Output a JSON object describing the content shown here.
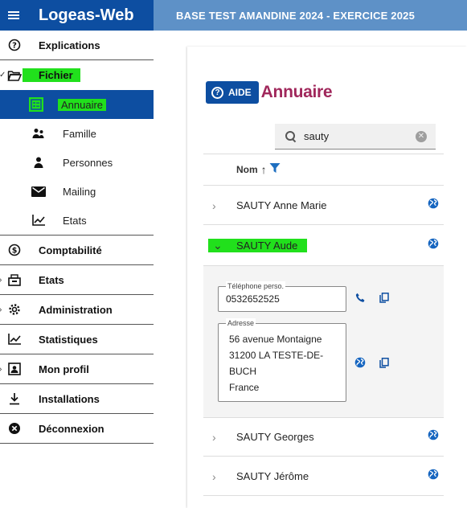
{
  "app": {
    "title": "Logeas-Web",
    "banner": "BASE TEST AMANDINE 2024 - EXERCICE 2025"
  },
  "sidebar": {
    "items": [
      {
        "label": "Explications",
        "icon": "help-circle-icon"
      },
      {
        "label": "Fichier",
        "icon": "folder-open-icon",
        "expanded": true
      },
      {
        "label": "Comptabilité",
        "icon": "dollar-circle-icon"
      },
      {
        "label": "Etats",
        "icon": "printer-icon"
      },
      {
        "label": "Administration",
        "icon": "gear-icon"
      },
      {
        "label": "Statistiques",
        "icon": "chart-line-icon"
      },
      {
        "label": "Mon profil",
        "icon": "id-card-icon"
      },
      {
        "label": "Installations",
        "icon": "download-icon"
      },
      {
        "label": "Déconnexion",
        "icon": "logout-circle-icon"
      }
    ],
    "fichier_sub": [
      {
        "label": "Annuaire",
        "icon": "address-book-icon",
        "active": true
      },
      {
        "label": "Famille",
        "icon": "family-icon"
      },
      {
        "label": "Personnes",
        "icon": "person-icon"
      },
      {
        "label": "Mailing",
        "icon": "envelope-icon"
      },
      {
        "label": "Etats",
        "icon": "chart-icon"
      }
    ]
  },
  "main": {
    "help_button": "AIDE",
    "page_title": "Annuaire",
    "search": {
      "value": "sauty"
    },
    "sort": {
      "label": "Nom"
    },
    "rows": [
      {
        "name": "SAUTY Anne Marie"
      },
      {
        "name": "SAUTY Aude",
        "expanded": true
      },
      {
        "name": "SAUTY Georges"
      },
      {
        "name": "SAUTY Jérôme"
      }
    ],
    "detail": {
      "phone_label": "Téléphone perso.",
      "phone_value": "0532652525",
      "address_label": "Adresse",
      "address_lines": [
        "56 avenue Montaigne",
        "31200 LA TESTE-DE-",
        "BUCH",
        "France"
      ]
    }
  },
  "colors": {
    "primary": "#0d4ea1",
    "banner": "#5e91c7",
    "title": "#a0275b",
    "highlight": "#21e01c"
  }
}
